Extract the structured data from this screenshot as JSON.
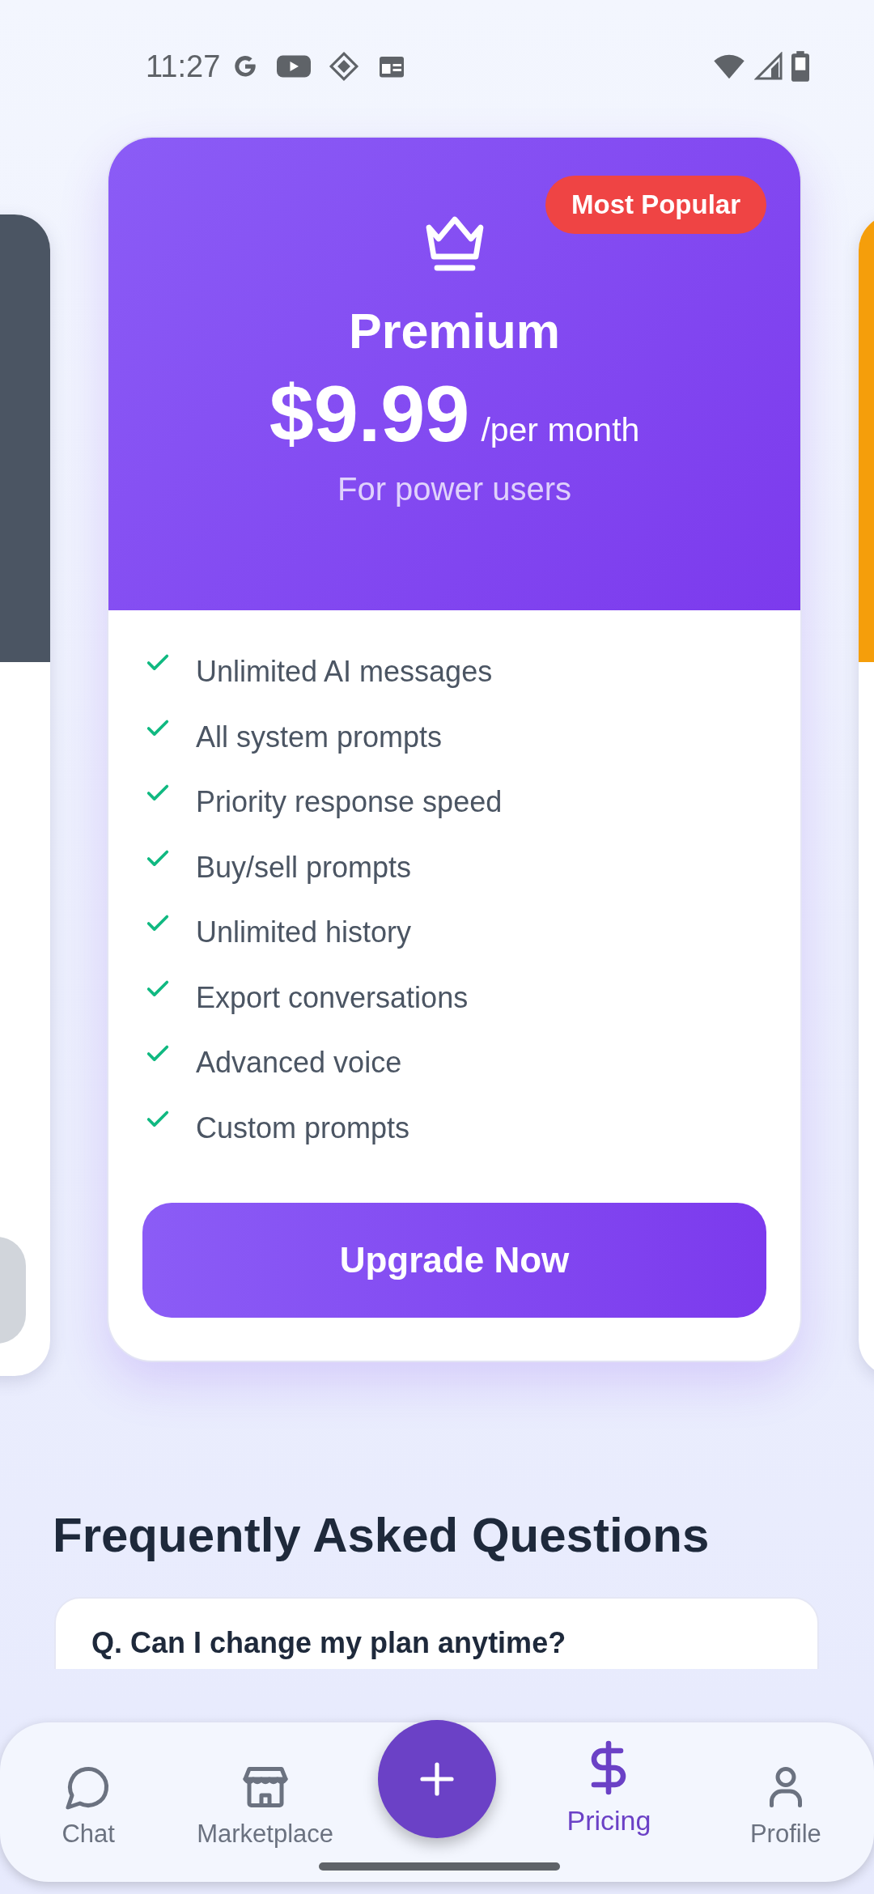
{
  "status_bar": {
    "time": "11:27"
  },
  "side_plans": [
    {
      "color": "#4b5563"
    },
    {
      "color": "#f59e0b"
    }
  ],
  "plan": {
    "badge": "Most Popular",
    "name": "Premium",
    "price": "$9.99",
    "period": "/per month",
    "subtitle": "For power users",
    "features": [
      "Unlimited AI messages",
      "All system prompts",
      "Priority response speed",
      "Buy/sell prompts",
      "Unlimited history",
      "Export conversations",
      "Advanced voice",
      "Custom prompts"
    ],
    "button": "Upgrade Now"
  },
  "faq": {
    "title": "Frequently Asked Questions",
    "questions": [
      "Q. Can I change my plan anytime?"
    ]
  },
  "bottom_nav": [
    {
      "kind": "tab",
      "label": "Chat",
      "selected": false
    },
    {
      "kind": "tab",
      "label": "Marketplace",
      "selected": false
    },
    {
      "kind": "fab"
    },
    {
      "kind": "tab",
      "label": "Pricing",
      "selected": true
    },
    {
      "kind": "tab",
      "label": "Profile",
      "selected": false
    }
  ]
}
